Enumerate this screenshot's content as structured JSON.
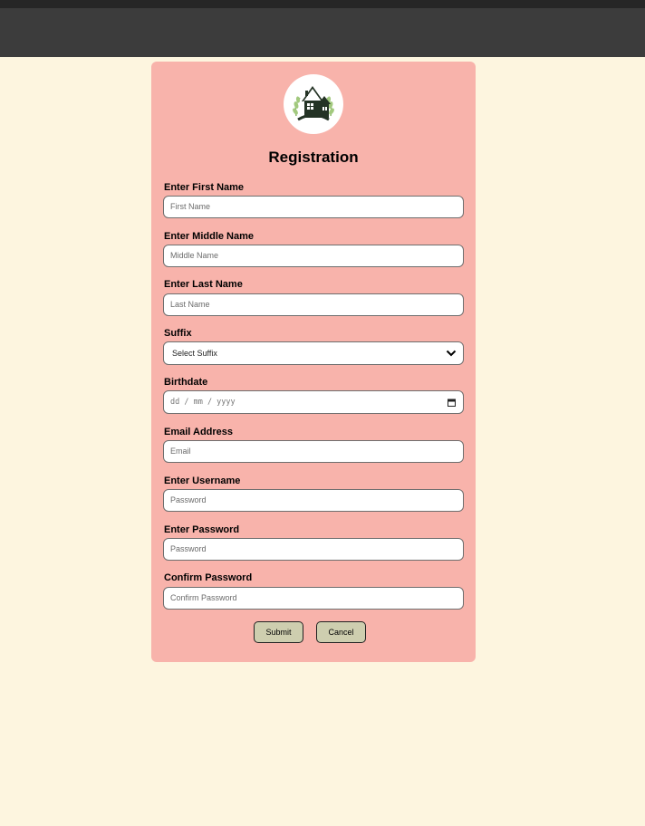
{
  "form": {
    "title": "Registration",
    "fields": [
      {
        "label": "Enter First Name",
        "placeholder": "First Name"
      },
      {
        "label": "Enter Middle Name",
        "placeholder": "Middle Name"
      },
      {
        "label": "Enter Last Name",
        "placeholder": "Last Name"
      },
      {
        "label": "Suffix",
        "value": "Select Suffix"
      },
      {
        "label": "Birthdate",
        "placeholder": "dd / mm / yyyy"
      },
      {
        "label": "Email Address",
        "placeholder": "Email"
      },
      {
        "label": "Enter Username",
        "placeholder": "Password"
      },
      {
        "label": "Enter Password",
        "placeholder": "Password"
      },
      {
        "label": "Confirm Password",
        "placeholder": "Confirm Password"
      }
    ],
    "submit_label": "Submit",
    "cancel_label": "Cancel"
  },
  "icons": {
    "logo": "house-logo-icon",
    "suffix_dropdown": "chevron-down-icon",
    "birthdate_picker": "calendar-icon"
  },
  "colors": {
    "page_background": "#fdf5df",
    "header": "#3c3c3c",
    "card": "#f8b3ab",
    "button": "#ceceaf"
  }
}
